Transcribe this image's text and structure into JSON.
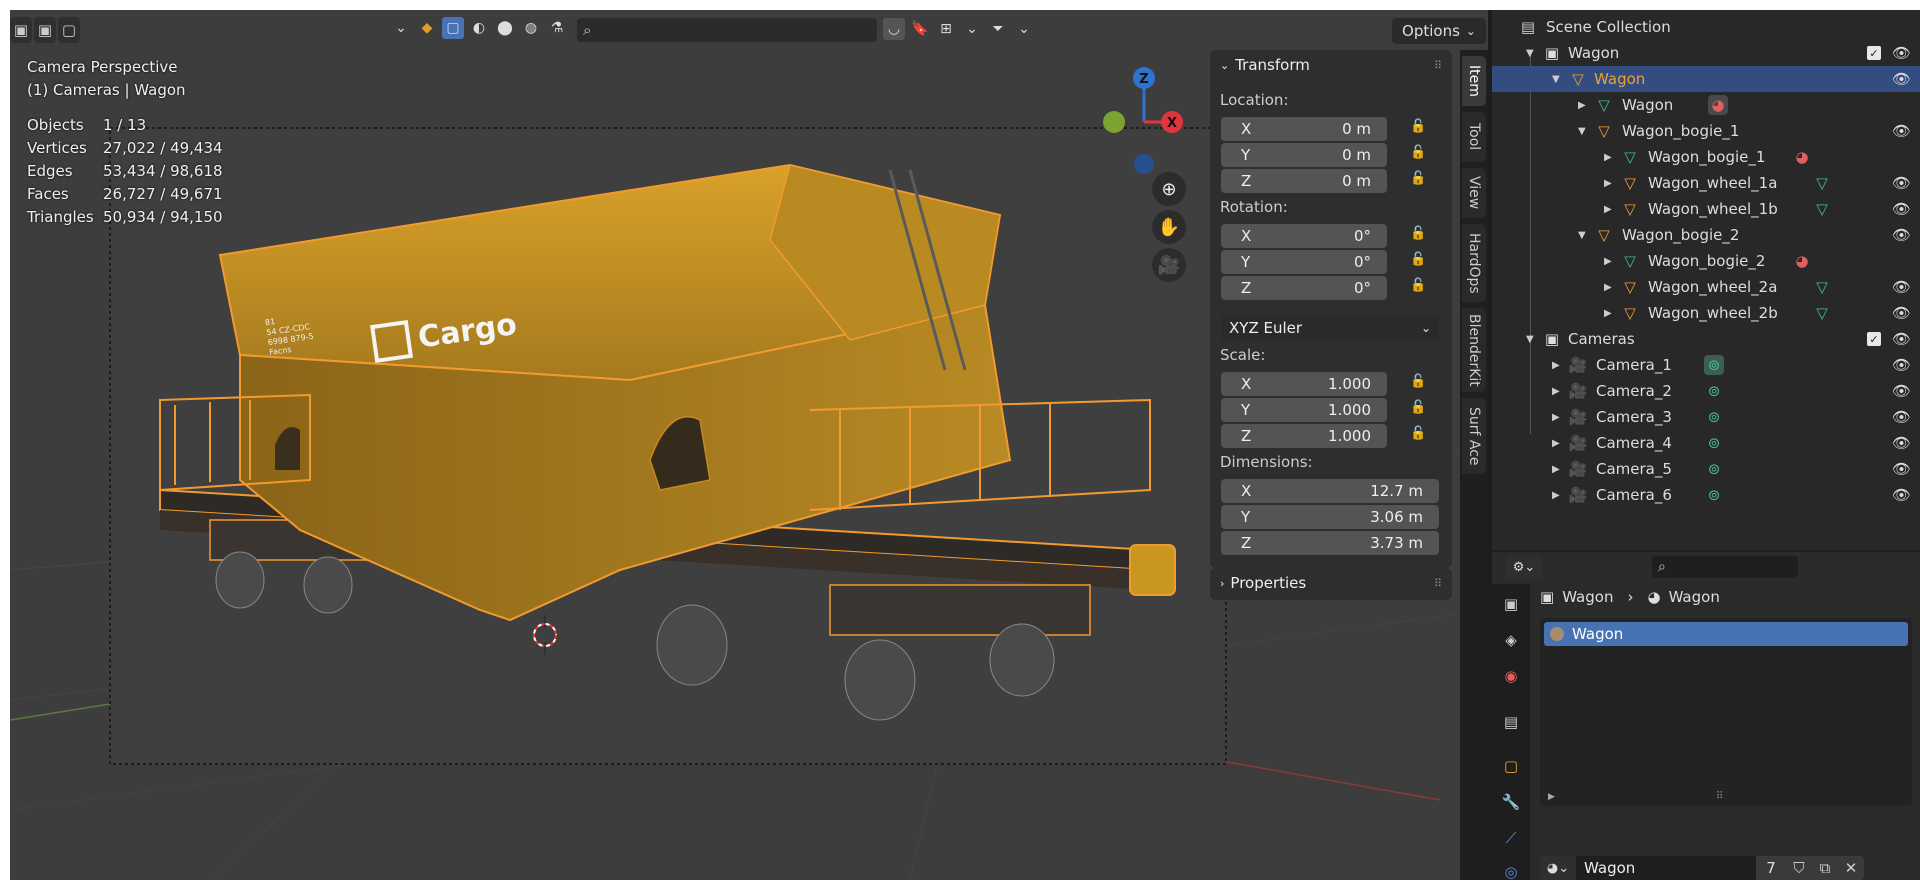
{
  "viewport": {
    "header": {
      "search_placeholder": "",
      "options_label": "Options"
    },
    "overlay": {
      "view_name": "Camera Perspective",
      "collection_line": "(1) Cameras | Wagon",
      "stats": [
        {
          "label": "Objects",
          "value": "1 / 13"
        },
        {
          "label": "Vertices",
          "value": "27,022 / 49,434"
        },
        {
          "label": "Edges",
          "value": "53,434 / 98,618"
        },
        {
          "label": "Faces",
          "value": "26,727 / 49,671"
        },
        {
          "label": "Triangles",
          "value": "50,934 / 94,150"
        }
      ]
    },
    "gizmo": {
      "z": "Z",
      "x": "X"
    },
    "wagon_logo": "Cargo",
    "wagon_code_lines": [
      "81",
      "54 CZ-CDC",
      "6998 879-5",
      "Facns"
    ]
  },
  "n_panel": {
    "transform_title": "Transform",
    "location_label": "Location:",
    "location": [
      {
        "axis": "X",
        "value": "0 m"
      },
      {
        "axis": "Y",
        "value": "0 m"
      },
      {
        "axis": "Z",
        "value": "0 m"
      }
    ],
    "rotation_label": "Rotation:",
    "rotation": [
      {
        "axis": "X",
        "value": "0°"
      },
      {
        "axis": "Y",
        "value": "0°"
      },
      {
        "axis": "Z",
        "value": "0°"
      }
    ],
    "rotation_mode": "XYZ Euler",
    "scale_label": "Scale:",
    "scale": [
      {
        "axis": "X",
        "value": "1.000"
      },
      {
        "axis": "Y",
        "value": "1.000"
      },
      {
        "axis": "Z",
        "value": "1.000"
      }
    ],
    "dimensions_label": "Dimensions:",
    "dimensions": [
      {
        "axis": "X",
        "value": "12.7 m"
      },
      {
        "axis": "Y",
        "value": "3.06 m"
      },
      {
        "axis": "Z",
        "value": "3.73 m"
      }
    ],
    "properties_title": "Properties",
    "tabs": [
      "Item",
      "Tool",
      "View",
      "HardOps",
      "BlenderKit",
      "Surf Ace"
    ]
  },
  "outliner": {
    "root": "Scene Collection",
    "rows": [
      {
        "label": "Wagon",
        "kind": "collection"
      },
      {
        "label": "Wagon",
        "kind": "empty",
        "selected": true
      },
      {
        "label": "Wagon",
        "kind": "mesh"
      },
      {
        "label": "Wagon_bogie_1",
        "kind": "empty"
      },
      {
        "label": "Wagon_bogie_1",
        "kind": "mesh"
      },
      {
        "label": "Wagon_wheel_1a",
        "kind": "empty"
      },
      {
        "label": "Wagon_wheel_1b",
        "kind": "empty"
      },
      {
        "label": "Wagon_bogie_2",
        "kind": "empty"
      },
      {
        "label": "Wagon_bogie_2",
        "kind": "mesh"
      },
      {
        "label": "Wagon_wheel_2a",
        "kind": "empty"
      },
      {
        "label": "Wagon_wheel_2b",
        "kind": "empty"
      },
      {
        "label": "Cameras",
        "kind": "collection"
      },
      {
        "label": "Camera_1",
        "kind": "camera"
      },
      {
        "label": "Camera_2",
        "kind": "camera"
      },
      {
        "label": "Camera_3",
        "kind": "camera"
      },
      {
        "label": "Camera_4",
        "kind": "camera"
      },
      {
        "label": "Camera_5",
        "kind": "camera"
      },
      {
        "label": "Camera_6",
        "kind": "camera"
      }
    ]
  },
  "properties": {
    "search_placeholder": "",
    "breadcrumb_object": "Wagon",
    "breadcrumb_material": "Wagon",
    "material_item": "Wagon",
    "material_name": "Wagon",
    "user_count": "7"
  },
  "colors": {
    "selection": "#334d80",
    "accent_orange": "#f0a030",
    "mesh_green": "#3fc08a",
    "material_red": "#e06060",
    "axis_x": "#e0353c",
    "axis_z": "#2f72d0",
    "axis_y": "#7aa334"
  }
}
